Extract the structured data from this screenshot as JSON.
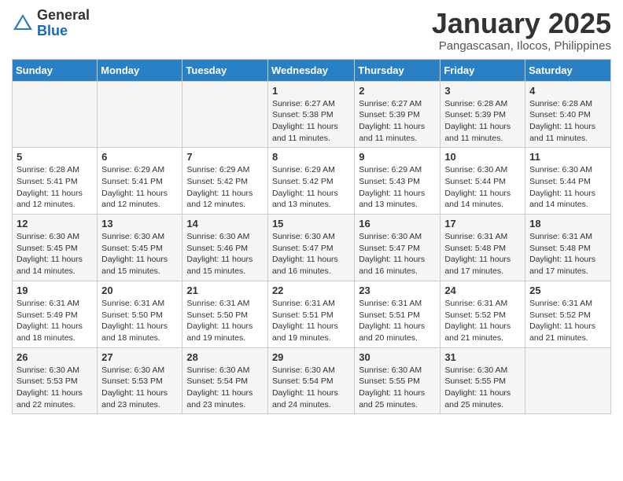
{
  "header": {
    "logo_general": "General",
    "logo_blue": "Blue",
    "month_title": "January 2025",
    "subtitle": "Pangascasan, Ilocos, Philippines"
  },
  "days_of_week": [
    "Sunday",
    "Monday",
    "Tuesday",
    "Wednesday",
    "Thursday",
    "Friday",
    "Saturday"
  ],
  "weeks": [
    [
      {
        "day": "",
        "sunrise": "",
        "sunset": "",
        "daylight": ""
      },
      {
        "day": "",
        "sunrise": "",
        "sunset": "",
        "daylight": ""
      },
      {
        "day": "",
        "sunrise": "",
        "sunset": "",
        "daylight": ""
      },
      {
        "day": "1",
        "sunrise": "Sunrise: 6:27 AM",
        "sunset": "Sunset: 5:38 PM",
        "daylight": "Daylight: 11 hours and 11 minutes."
      },
      {
        "day": "2",
        "sunrise": "Sunrise: 6:27 AM",
        "sunset": "Sunset: 5:39 PM",
        "daylight": "Daylight: 11 hours and 11 minutes."
      },
      {
        "day": "3",
        "sunrise": "Sunrise: 6:28 AM",
        "sunset": "Sunset: 5:39 PM",
        "daylight": "Daylight: 11 hours and 11 minutes."
      },
      {
        "day": "4",
        "sunrise": "Sunrise: 6:28 AM",
        "sunset": "Sunset: 5:40 PM",
        "daylight": "Daylight: 11 hours and 11 minutes."
      }
    ],
    [
      {
        "day": "5",
        "sunrise": "Sunrise: 6:28 AM",
        "sunset": "Sunset: 5:41 PM",
        "daylight": "Daylight: 11 hours and 12 minutes."
      },
      {
        "day": "6",
        "sunrise": "Sunrise: 6:29 AM",
        "sunset": "Sunset: 5:41 PM",
        "daylight": "Daylight: 11 hours and 12 minutes."
      },
      {
        "day": "7",
        "sunrise": "Sunrise: 6:29 AM",
        "sunset": "Sunset: 5:42 PM",
        "daylight": "Daylight: 11 hours and 12 minutes."
      },
      {
        "day": "8",
        "sunrise": "Sunrise: 6:29 AM",
        "sunset": "Sunset: 5:42 PM",
        "daylight": "Daylight: 11 hours and 13 minutes."
      },
      {
        "day": "9",
        "sunrise": "Sunrise: 6:29 AM",
        "sunset": "Sunset: 5:43 PM",
        "daylight": "Daylight: 11 hours and 13 minutes."
      },
      {
        "day": "10",
        "sunrise": "Sunrise: 6:30 AM",
        "sunset": "Sunset: 5:44 PM",
        "daylight": "Daylight: 11 hours and 14 minutes."
      },
      {
        "day": "11",
        "sunrise": "Sunrise: 6:30 AM",
        "sunset": "Sunset: 5:44 PM",
        "daylight": "Daylight: 11 hours and 14 minutes."
      }
    ],
    [
      {
        "day": "12",
        "sunrise": "Sunrise: 6:30 AM",
        "sunset": "Sunset: 5:45 PM",
        "daylight": "Daylight: 11 hours and 14 minutes."
      },
      {
        "day": "13",
        "sunrise": "Sunrise: 6:30 AM",
        "sunset": "Sunset: 5:45 PM",
        "daylight": "Daylight: 11 hours and 15 minutes."
      },
      {
        "day": "14",
        "sunrise": "Sunrise: 6:30 AM",
        "sunset": "Sunset: 5:46 PM",
        "daylight": "Daylight: 11 hours and 15 minutes."
      },
      {
        "day": "15",
        "sunrise": "Sunrise: 6:30 AM",
        "sunset": "Sunset: 5:47 PM",
        "daylight": "Daylight: 11 hours and 16 minutes."
      },
      {
        "day": "16",
        "sunrise": "Sunrise: 6:30 AM",
        "sunset": "Sunset: 5:47 PM",
        "daylight": "Daylight: 11 hours and 16 minutes."
      },
      {
        "day": "17",
        "sunrise": "Sunrise: 6:31 AM",
        "sunset": "Sunset: 5:48 PM",
        "daylight": "Daylight: 11 hours and 17 minutes."
      },
      {
        "day": "18",
        "sunrise": "Sunrise: 6:31 AM",
        "sunset": "Sunset: 5:48 PM",
        "daylight": "Daylight: 11 hours and 17 minutes."
      }
    ],
    [
      {
        "day": "19",
        "sunrise": "Sunrise: 6:31 AM",
        "sunset": "Sunset: 5:49 PM",
        "daylight": "Daylight: 11 hours and 18 minutes."
      },
      {
        "day": "20",
        "sunrise": "Sunrise: 6:31 AM",
        "sunset": "Sunset: 5:50 PM",
        "daylight": "Daylight: 11 hours and 18 minutes."
      },
      {
        "day": "21",
        "sunrise": "Sunrise: 6:31 AM",
        "sunset": "Sunset: 5:50 PM",
        "daylight": "Daylight: 11 hours and 19 minutes."
      },
      {
        "day": "22",
        "sunrise": "Sunrise: 6:31 AM",
        "sunset": "Sunset: 5:51 PM",
        "daylight": "Daylight: 11 hours and 19 minutes."
      },
      {
        "day": "23",
        "sunrise": "Sunrise: 6:31 AM",
        "sunset": "Sunset: 5:51 PM",
        "daylight": "Daylight: 11 hours and 20 minutes."
      },
      {
        "day": "24",
        "sunrise": "Sunrise: 6:31 AM",
        "sunset": "Sunset: 5:52 PM",
        "daylight": "Daylight: 11 hours and 21 minutes."
      },
      {
        "day": "25",
        "sunrise": "Sunrise: 6:31 AM",
        "sunset": "Sunset: 5:52 PM",
        "daylight": "Daylight: 11 hours and 21 minutes."
      }
    ],
    [
      {
        "day": "26",
        "sunrise": "Sunrise: 6:30 AM",
        "sunset": "Sunset: 5:53 PM",
        "daylight": "Daylight: 11 hours and 22 minutes."
      },
      {
        "day": "27",
        "sunrise": "Sunrise: 6:30 AM",
        "sunset": "Sunset: 5:53 PM",
        "daylight": "Daylight: 11 hours and 23 minutes."
      },
      {
        "day": "28",
        "sunrise": "Sunrise: 6:30 AM",
        "sunset": "Sunset: 5:54 PM",
        "daylight": "Daylight: 11 hours and 23 minutes."
      },
      {
        "day": "29",
        "sunrise": "Sunrise: 6:30 AM",
        "sunset": "Sunset: 5:54 PM",
        "daylight": "Daylight: 11 hours and 24 minutes."
      },
      {
        "day": "30",
        "sunrise": "Sunrise: 6:30 AM",
        "sunset": "Sunset: 5:55 PM",
        "daylight": "Daylight: 11 hours and 25 minutes."
      },
      {
        "day": "31",
        "sunrise": "Sunrise: 6:30 AM",
        "sunset": "Sunset: 5:55 PM",
        "daylight": "Daylight: 11 hours and 25 minutes."
      },
      {
        "day": "",
        "sunrise": "",
        "sunset": "",
        "daylight": ""
      }
    ]
  ]
}
